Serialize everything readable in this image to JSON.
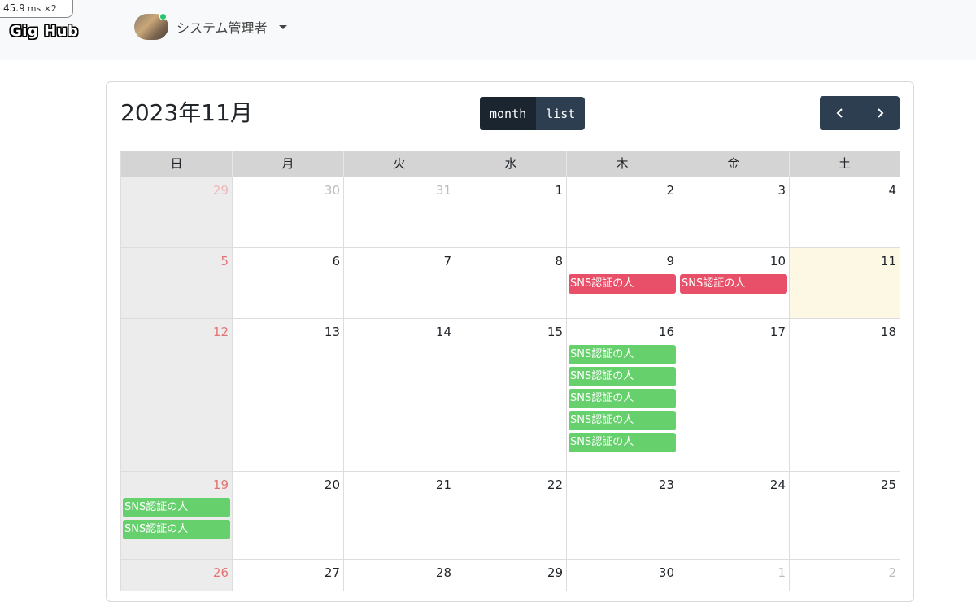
{
  "perf": {
    "value": "45.9",
    "unit": "ms ×2"
  },
  "navbar": {
    "brand": "Gig Hub",
    "username": "システム管理者"
  },
  "calendar": {
    "title": "2023年11月",
    "views": {
      "month": "month",
      "list": "list"
    },
    "weekdays": [
      "日",
      "月",
      "火",
      "水",
      "木",
      "金",
      "土"
    ],
    "event_label": "SNS認証の人",
    "colors": {
      "red_event": "#e8506a",
      "green_event": "#66d06d",
      "button": "#2c3e50",
      "today": "#fcf8e3"
    },
    "weeks": [
      [
        "29",
        "30",
        "31",
        "1",
        "2",
        "3",
        "4"
      ],
      [
        "5",
        "6",
        "7",
        "8",
        "9",
        "10",
        "11"
      ],
      [
        "12",
        "13",
        "14",
        "15",
        "16",
        "17",
        "18"
      ],
      [
        "19",
        "20",
        "21",
        "22",
        "23",
        "24",
        "25"
      ],
      [
        "26",
        "27",
        "28",
        "29",
        "30",
        "1",
        "2"
      ]
    ]
  }
}
